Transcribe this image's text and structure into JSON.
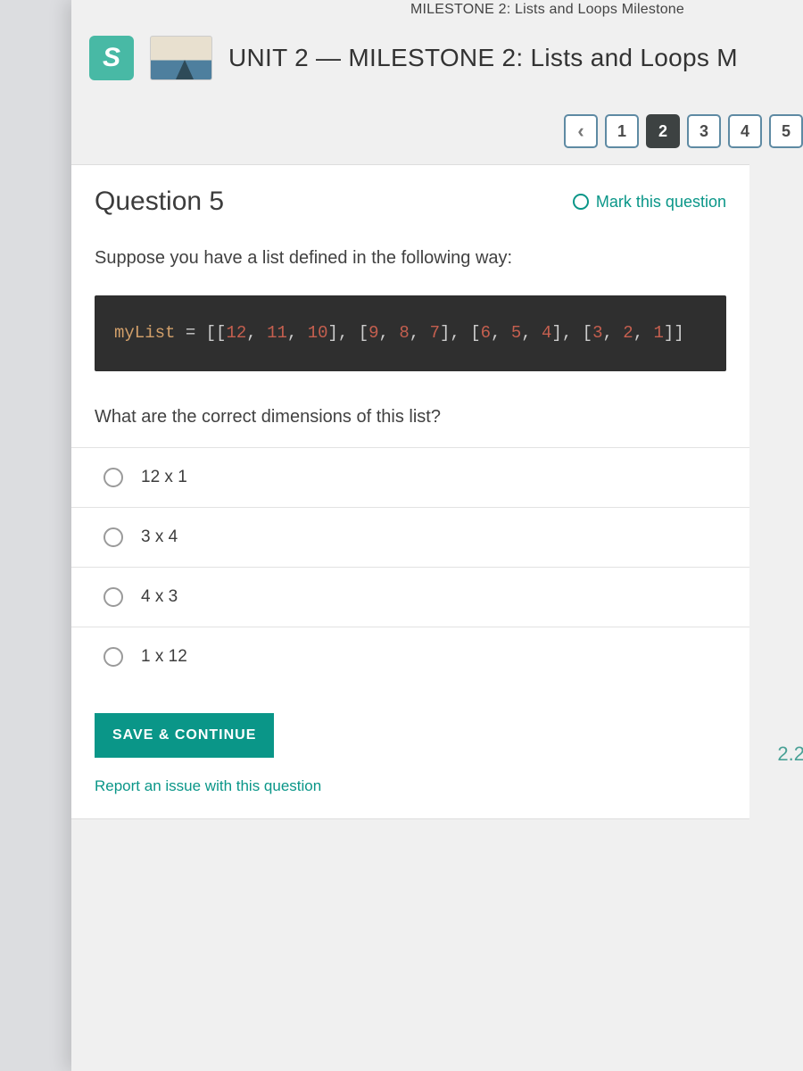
{
  "topstrip": "MILESTONE 2: Lists and Loops Milestone",
  "header": {
    "logo_text": "S",
    "unit_title": "UNIT 2 — MILESTONE 2: Lists and Loops M"
  },
  "pager": {
    "prev": "‹",
    "items": [
      "1",
      "2",
      "3",
      "4",
      "5"
    ],
    "current_index": 1
  },
  "question": {
    "title": "Question 5",
    "mark_label": "Mark this question",
    "prompt": "Suppose you have a list defined in the following way:",
    "code_var": "myList",
    "code_eq": " = ",
    "code_vals": [
      [
        12,
        11,
        10
      ],
      [
        9,
        8,
        7
      ],
      [
        6,
        5,
        4
      ],
      [
        3,
        2,
        1
      ]
    ],
    "followup": "What are the correct dimensions of this list?",
    "options": [
      "12 x 1",
      "3 x 4",
      "4 x 3",
      "1 x 12"
    ],
    "save_label": "SAVE & CONTINUE",
    "report_label": "Report an issue with this question"
  },
  "floater": "2.2"
}
